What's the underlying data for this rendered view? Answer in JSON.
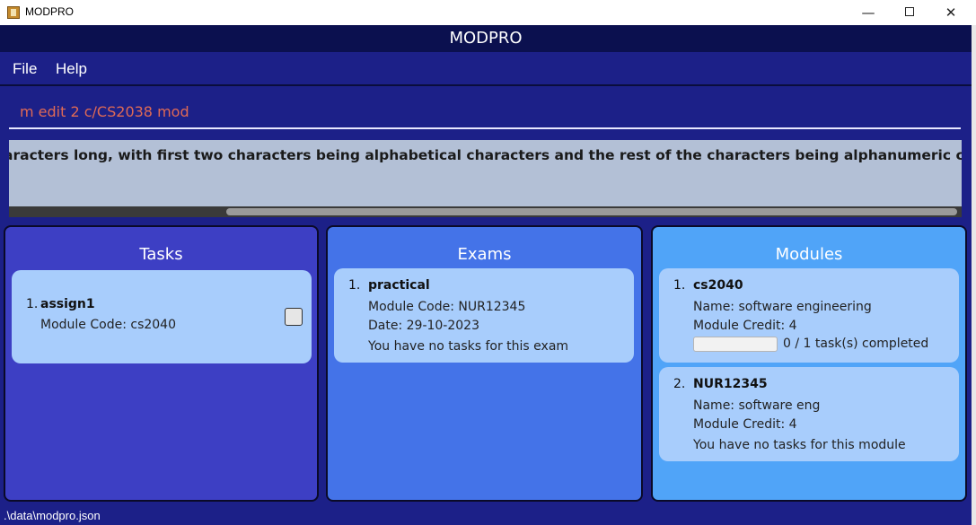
{
  "window": {
    "title": "MODPRO",
    "icons": {
      "app": "app-icon",
      "minimize": "minimize-icon",
      "maximize": "maximize-icon",
      "close": "close-icon"
    }
  },
  "app": {
    "header": "MODPRO"
  },
  "menu": {
    "file": "File",
    "help": "Help"
  },
  "command": {
    "value": "m edit 2 c/CS2038 mod"
  },
  "result": {
    "text": "aracters long, with first two characters being alphabetical characters and the rest of the characters being alphanumeric characters"
  },
  "panels": {
    "tasks": {
      "title": "Tasks",
      "items": [
        {
          "index": "1.",
          "name": "assign1",
          "module_code": "Module Code: cs2040",
          "done": false
        }
      ]
    },
    "exams": {
      "title": "Exams",
      "items": [
        {
          "index": "1.",
          "name": "practical",
          "module_code": "Module Code: NUR12345",
          "date": "Date: 29-10-2023",
          "note": "You have no tasks for this exam"
        }
      ]
    },
    "modules": {
      "title": "Modules",
      "items": [
        {
          "index": "1.",
          "name": "cs2040",
          "full_name": "Name: software engineering",
          "credit": "Module Credit: 4",
          "progress_fraction": 0,
          "progress_text": "0 / 1 task(s) completed"
        },
        {
          "index": "2.",
          "name": "NUR12345",
          "full_name": "Name: software eng",
          "credit": "Module Credit: 4",
          "note": "You have no tasks for this module"
        }
      ]
    }
  },
  "status": {
    "path": ".\\data\\modpro.json"
  },
  "colors": {
    "background": "#1c2088",
    "header": "#0b104f",
    "tasks_panel": "#3d3fc4",
    "exams_panel": "#4473e8",
    "modules_panel": "#50a4f8",
    "card": "#a8cdfc",
    "command_text": "#e06a55"
  }
}
